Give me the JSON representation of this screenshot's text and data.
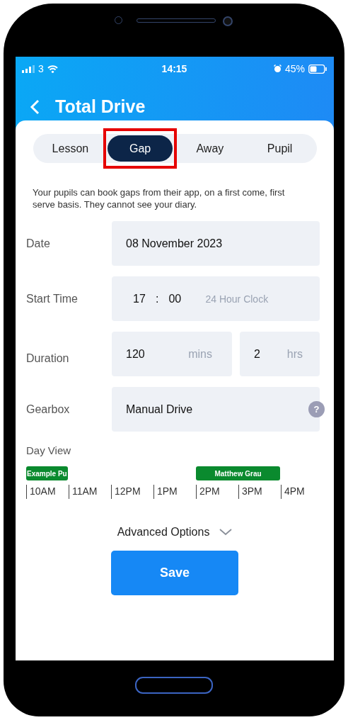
{
  "status_bar": {
    "carrier": "3",
    "time": "14:15",
    "battery": "45%"
  },
  "header": {
    "title": "Total Drive"
  },
  "tabs": [
    {
      "label": "Lesson",
      "selected": false,
      "highlighted": false
    },
    {
      "label": "Gap",
      "selected": true,
      "highlighted": true
    },
    {
      "label": "Away",
      "selected": false,
      "highlighted": false
    },
    {
      "label": "Pupil",
      "selected": false,
      "highlighted": false
    }
  ],
  "description": "Your pupils can book gaps from their app, on a first come, first serve basis. They cannot see your diary.",
  "form": {
    "date": {
      "label": "Date",
      "value": "08 November 2023"
    },
    "start_time": {
      "label": "Start Time",
      "hours": "17",
      "separator": ":",
      "minutes": "00",
      "hint": "24 Hour Clock"
    },
    "duration": {
      "label": "Duration",
      "minutes": "120",
      "minutes_unit": "mins",
      "hours": "2",
      "hours_unit": "hrs"
    },
    "gearbox": {
      "label": "Gearbox",
      "value": "Manual Drive",
      "help": "?"
    }
  },
  "day_view": {
    "label": "Day View",
    "hours": [
      {
        "label": "10AM",
        "event": {
          "title": "Example Pu",
          "kind": "single"
        }
      },
      {
        "label": "11AM"
      },
      {
        "label": "12PM"
      },
      {
        "label": "1PM"
      },
      {
        "label": "2PM",
        "event": {
          "title": "Matthew Grau",
          "kind": "double"
        }
      },
      {
        "label": "3PM"
      },
      {
        "label": "4PM"
      }
    ]
  },
  "advanced_options": {
    "label": "Advanced Options",
    "expanded": false
  },
  "save_button": "Save"
}
